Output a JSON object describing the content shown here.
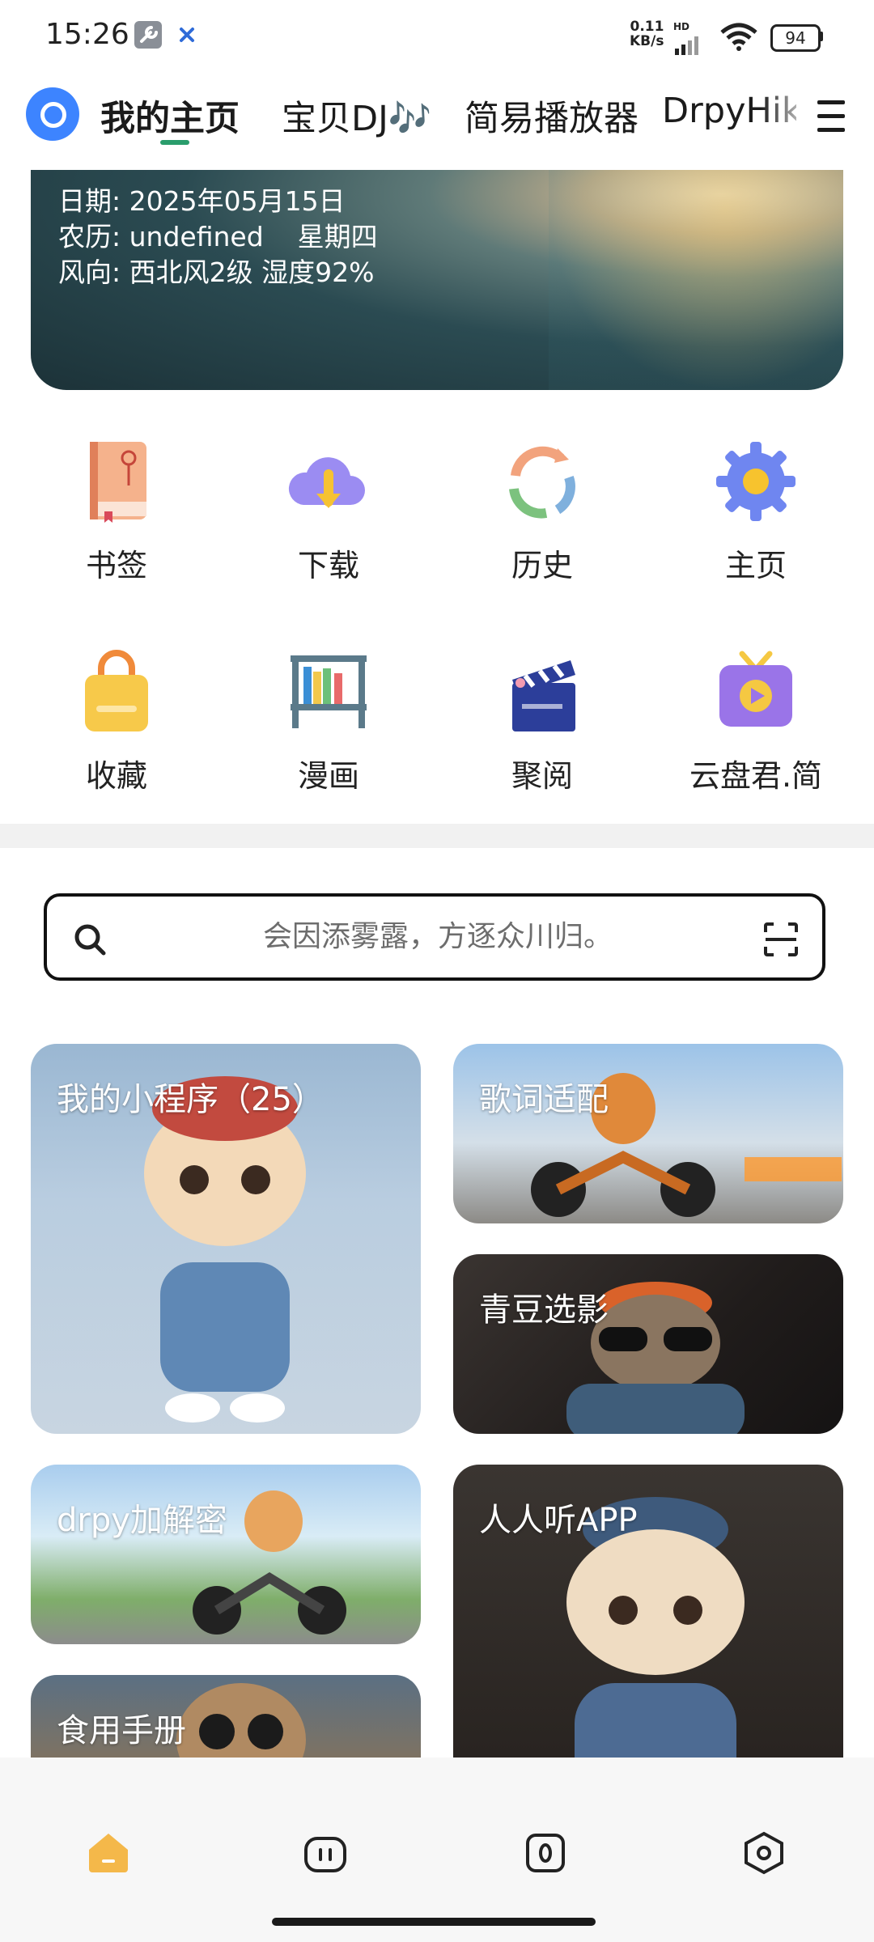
{
  "status_bar": {
    "time": "15:26",
    "net_speed": "0.11",
    "net_unit": "KB/s",
    "signal_tag": "HD",
    "battery": "94"
  },
  "header": {
    "tabs": [
      "我的主页",
      "宝贝DJ🎶",
      "简易播放器",
      "DrpyHike"
    ],
    "active_tab": 0
  },
  "weather": {
    "date": "日期: 2025年05月15日",
    "lunar": "农历: undefined    星期四",
    "wind": "风向: 西北风2级 湿度92%"
  },
  "grid": {
    "items": [
      {
        "label": "书签",
        "icon": "bookmark-book-icon"
      },
      {
        "label": "下载",
        "icon": "cloud-download-icon"
      },
      {
        "label": "历史",
        "icon": "history-cycle-icon"
      },
      {
        "label": "主页",
        "icon": "gear-icon"
      },
      {
        "label": "收藏",
        "icon": "shopping-bag-icon"
      },
      {
        "label": "漫画",
        "icon": "bookshelf-icon"
      },
      {
        "label": "聚阅",
        "icon": "clapperboard-icon"
      },
      {
        "label": "云盘君.简",
        "icon": "tv-play-icon"
      }
    ]
  },
  "search": {
    "placeholder": "会因添雾露，方逐众川归。"
  },
  "cards": [
    {
      "title": "我的小程序（25）"
    },
    {
      "title": "歌词适配"
    },
    {
      "title": "青豆选影"
    },
    {
      "title": "drpy加解密"
    },
    {
      "title": "人人听APP"
    },
    {
      "title": "食用手册"
    }
  ],
  "bottom_nav": {
    "items": [
      "home-icon",
      "pause-face-icon",
      "zero-square-icon",
      "hexagon-settings-icon"
    ],
    "active_color": "#f4b84a"
  }
}
